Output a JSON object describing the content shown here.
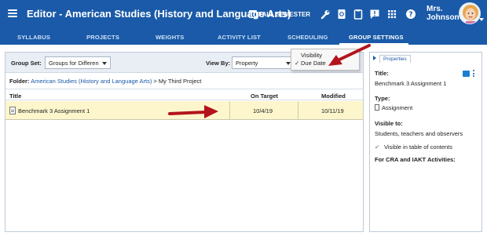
{
  "topbar": {
    "title": "Editor - American Studies (History and Language Arts)",
    "semester": "FALL SEMESTER",
    "user_line1": "Mrs.",
    "user_line2": "Johnson"
  },
  "nav": {
    "tabs": [
      "SYLLABUS",
      "PROJECTS",
      "WEIGHTS",
      "ACTIVITY LIST",
      "SCHEDULING",
      "GROUP SETTINGS"
    ],
    "active": "GROUP SETTINGS"
  },
  "toolbar": {
    "group_set_label": "Group Set:",
    "group_set_value": "Groups for Differen",
    "view_by_label": "View By:",
    "view_by_value": "Property"
  },
  "breadcrumb": {
    "label": "Folder:",
    "link": "American Studies (History and Language Arts)",
    "rest": " > My Third Project"
  },
  "table": {
    "columns": [
      "Title",
      "On Target",
      "Modified"
    ],
    "rows": [
      {
        "title": "Benchmark 3 Assignment 1",
        "on_target": "10/4/19",
        "modified": "10/11/19"
      }
    ]
  },
  "dropdown": {
    "items": [
      "Visibility",
      "Due Date"
    ],
    "checked": "Due Date",
    "check_glyph": "✓"
  },
  "properties": {
    "tab_label": "Properties",
    "title_label": "Title:",
    "title_value": "Benchmark 3 Assignment 1",
    "type_label": "Type:",
    "type_value": "Assignment",
    "visible_label": "Visible to:",
    "visible_value": "Students, teachers and observers",
    "toc_label": "Visible in table of contents",
    "cra_label": "For CRA and IAKT Activities:"
  },
  "colors": {
    "brand": "#1a5aa8",
    "selected_row": "#fdf6cc",
    "annotation_arrow": "#b3141c"
  }
}
